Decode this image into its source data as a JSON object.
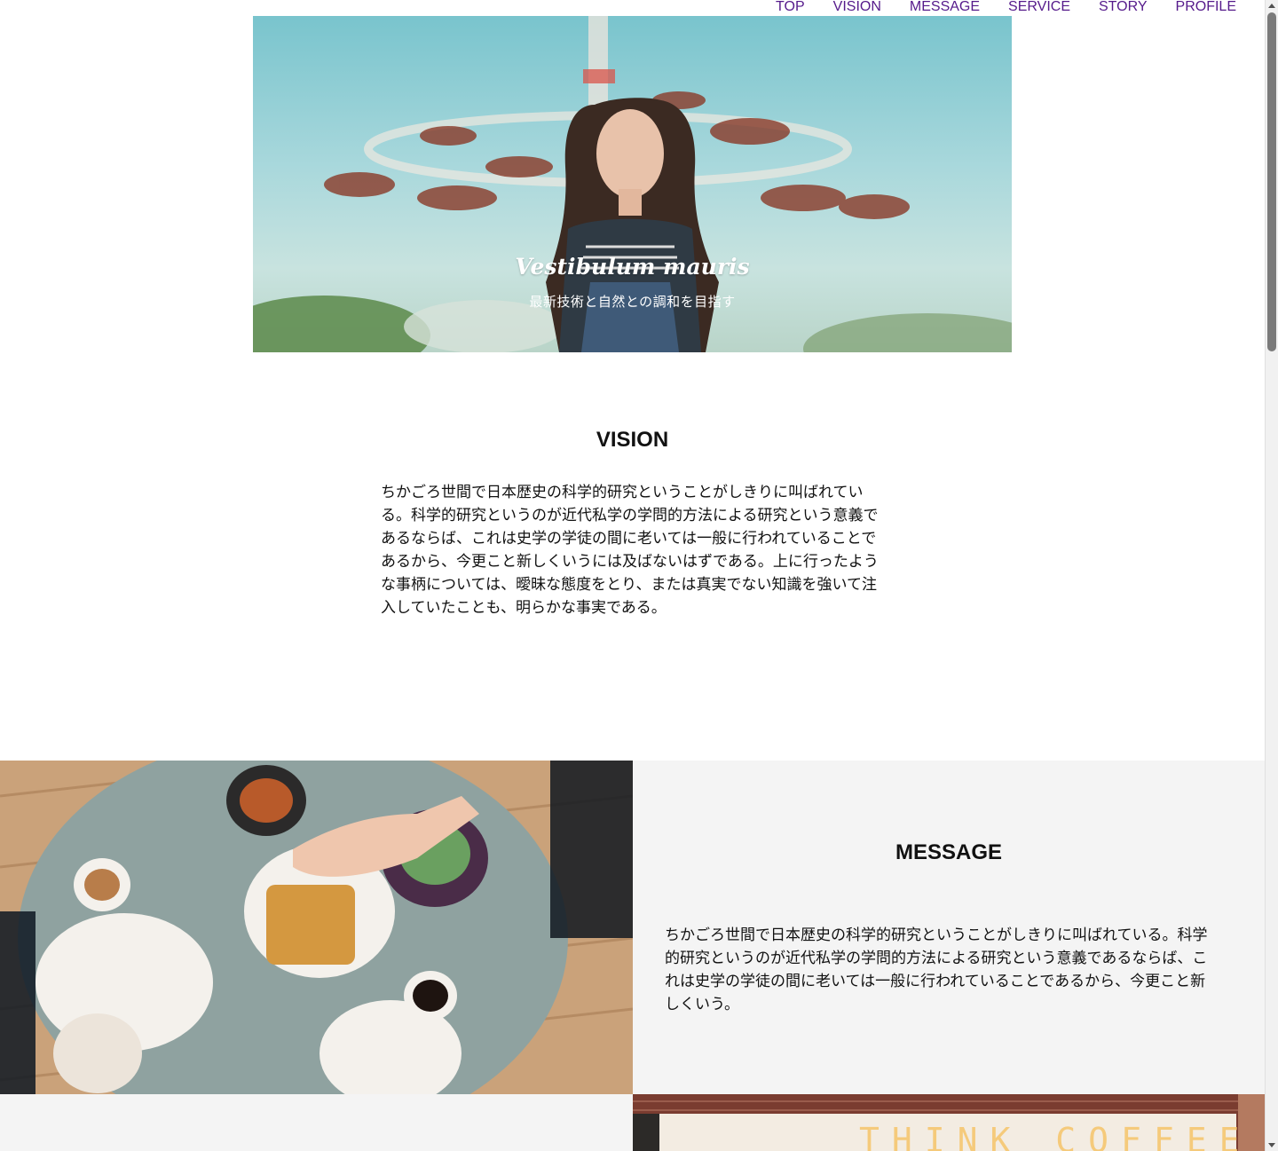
{
  "nav": {
    "items": [
      {
        "label": "TOP"
      },
      {
        "label": "VISION"
      },
      {
        "label": "MESSAGE"
      },
      {
        "label": "SERVICE"
      },
      {
        "label": "STORY"
      },
      {
        "label": "PROFILE"
      }
    ],
    "link_color": "#551a8b"
  },
  "hero": {
    "title": "Vestibulum mauris",
    "subtitle": "最新技術と自然との調和を目指す"
  },
  "vision": {
    "heading": "VISION",
    "body": "ちかごろ世間で日本歴史の科学的研究ということがしきりに叫ばれている。科学的研究というのが近代私学の学問的方法による研究という意義であるならば、これは史学の学徒の間に老いては一般に行われていることであるから、今更こと新しくいうには及ばないはずである。上に行ったような事柄については、曖昧な態度をとり、または真実でない知識を強いて注入していたことも、明らかな事実である。"
  },
  "message": {
    "heading": "MESSAGE",
    "body": "ちかごろ世間で日本歴史の科学的研究ということがしきりに叫ばれている。科学的研究というのが近代私学の学問的方法による研究という意義であるならば、これは史学の学徒の間に老いては一般に行われていることであるから、今更こと新しくいう。"
  },
  "bottom": {
    "sign_text": "THINK COFFEE"
  },
  "colors": {
    "panel_bg": "#f4f4f4",
    "text": "#111111"
  }
}
